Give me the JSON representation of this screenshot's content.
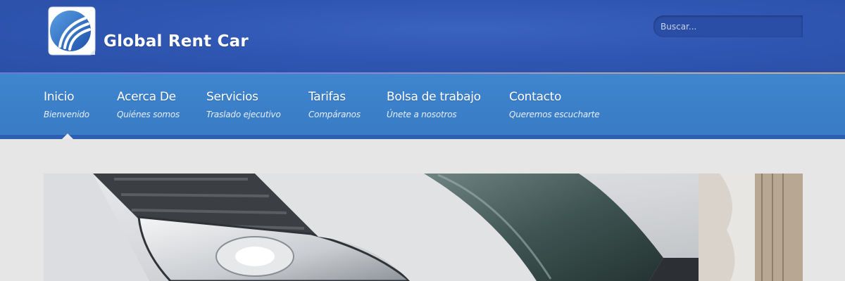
{
  "header": {
    "brand_name": "Global Rent Car",
    "logo_icon": "globe-swoosh-logo",
    "accent_color": "#2f57b3"
  },
  "search": {
    "placeholder": "Buscar..."
  },
  "nav": {
    "active_index": 0,
    "items": [
      {
        "label": "Inicio",
        "sub": "Bienvenido"
      },
      {
        "label": "Acerca De",
        "sub": "Quiénes somos"
      },
      {
        "label": "Servicios",
        "sub": "Traslado ejecutivo"
      },
      {
        "label": "Tarifas",
        "sub": "Compáranos"
      },
      {
        "label": "Bolsa de trabajo",
        "sub": "Únete a nosotros"
      },
      {
        "label": "Contacto",
        "sub": "Queremos escucharte"
      }
    ],
    "bar_color": "#3b7fc9"
  },
  "slider": {
    "image_subject": "car-headlight-photo"
  }
}
